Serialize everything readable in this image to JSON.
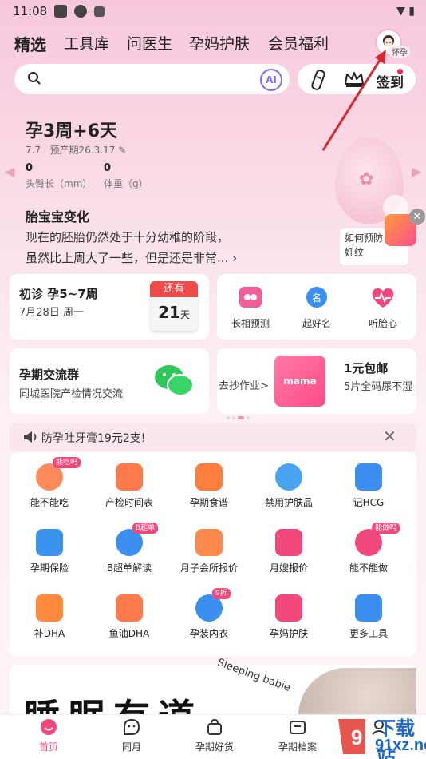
{
  "status": {
    "time": "11:08"
  },
  "top_tabs": [
    "精选",
    "工具库",
    "问医生",
    "孕妈护肤",
    "会员福利"
  ],
  "avatar_label": "怀孕",
  "search": {
    "ai_label": "AI",
    "signin_label": "签到"
  },
  "hero": {
    "week": "孕3周+6天",
    "date": "7.7",
    "due_label": "预产期26.3.17",
    "metrics": [
      {
        "value": "0",
        "label": "头臀长（mm）"
      },
      {
        "value": "0",
        "label": "体重（g）"
      }
    ],
    "change_title": "胎宝宝变化",
    "change_line1": "现在的胚胎仍然处于十分幼稚的阶段，",
    "change_line2": "虽然比上周大了一些，但是还是非常... ›",
    "promo_line1": "如何预防",
    "promo_line2": "妊纹"
  },
  "checkup": {
    "title": "初诊 孕5~7周",
    "date": "7月28日 周一",
    "cal_head": "还有",
    "cal_days": "21",
    "cal_unit": "天"
  },
  "tools3": [
    "长相预测",
    "起好名",
    "听胎心"
  ],
  "group": {
    "title": "孕期交流群",
    "subtitle": "同城医院产检情况交流"
  },
  "promo_right": {
    "homework": "去抄作业>",
    "box_label": "mama",
    "title": "1元包邮",
    "subtitle": "5片全码尿不湿"
  },
  "notice": {
    "text": "防孕吐牙膏19元2支!",
    "close": "✕"
  },
  "grid": [
    {
      "label": "能不能吃",
      "icon": "food-icon",
      "color": "#ff8a5b",
      "tag": "能吃吗"
    },
    {
      "label": "产检时间表",
      "icon": "calendar-check-icon",
      "color": "#ff7a4d"
    },
    {
      "label": "孕期食谱",
      "icon": "dish-cover-icon",
      "color": "#ff7e3e"
    },
    {
      "label": "禁用护肤品",
      "icon": "lotion-bottle-icon",
      "color": "#4aa3f0"
    },
    {
      "label": "记HCG",
      "icon": "hcg-shield-icon",
      "color": "#3c8ef0"
    },
    {
      "label": "孕期保险",
      "icon": "insurance-icon",
      "color": "#3b93ee"
    },
    {
      "label": "B超单解读",
      "icon": "ultrasound-report-icon",
      "color": "#3b8ff0",
      "tag": "B超单"
    },
    {
      "label": "月子会所报价",
      "icon": "house-icon",
      "color": "#ff8a4c"
    },
    {
      "label": "月嫂报价",
      "icon": "nanny-icon",
      "color": "#f2477a"
    },
    {
      "label": "能不能做",
      "icon": "activity-icon",
      "color": "#f2477a",
      "tag": "能做吗"
    },
    {
      "label": "补DHA",
      "icon": "dha-capsule-icon",
      "color": "#ff8a3d"
    },
    {
      "label": "鱼油DHA",
      "icon": "fish-icon",
      "color": "#ff7a4d"
    },
    {
      "label": "孕装内衣",
      "icon": "bra-icon",
      "color": "#3b8ff0",
      "tag": "9折"
    },
    {
      "label": "孕妈护肤",
      "icon": "skincare-face-icon",
      "color": "#f2477a"
    },
    {
      "label": "更多工具",
      "icon": "more-tools-icon",
      "color": "#3b8ff0"
    }
  ],
  "banner": {
    "big_text": "睡眠有道",
    "script_text": "Sleeping babie"
  },
  "bottom_nav": [
    {
      "label": "首页",
      "icon": "home-icon",
      "active": true
    },
    {
      "label": "同月",
      "icon": "chat-face-icon"
    },
    {
      "label": "孕期好货",
      "icon": "shopping-bag-icon"
    },
    {
      "label": "孕期档案",
      "icon": "archive-icon"
    },
    {
      "label": "",
      "icon": "profile-icon"
    }
  ],
  "watermark": {
    "cn": "下载站",
    "url": "91xz.net"
  },
  "colors": {
    "accent": "#f2477a",
    "ai_purple": "#7e6bf2",
    "calendar_red": "#f04b4b",
    "wechat_green": "#2ec75a"
  }
}
